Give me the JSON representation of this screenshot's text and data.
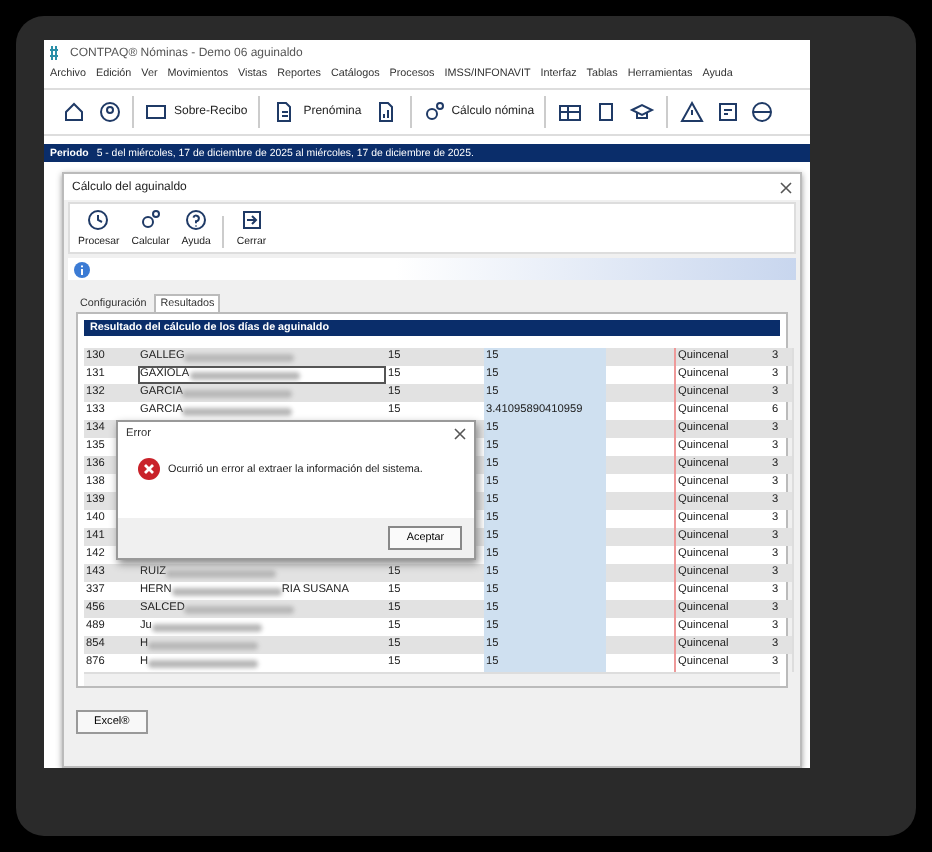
{
  "app_window": {
    "title": "CONTPAQ® Nóminas - Demo 06 aguinaldo"
  },
  "menu": [
    "Archivo",
    "Edición",
    "Ver",
    "Movimientos",
    "Vistas",
    "Reportes",
    "Catálogos",
    "Procesos",
    "IMSS/INFONAVIT",
    "Interfaz",
    "Tablas",
    "Herramientas",
    "Ayuda"
  ],
  "toolbar": [
    {
      "label": "Sobre-Recibo"
    },
    {
      "label": "Prenómina"
    },
    {
      "label": "Cálculo nómina"
    }
  ],
  "period": {
    "label": "Periodo",
    "text": "5 - del miércoles, 17 de diciembre de 2025 al miércoles, 17 de diciembre de 2025."
  },
  "dialog": {
    "title": "Cálculo del aguinaldo",
    "actions": [
      "Procesar",
      "Calcular",
      "Ayuda",
      "Cerrar"
    ],
    "tabs": [
      {
        "label": "Configuración",
        "selected": false
      },
      {
        "label": "Resultados",
        "selected": true
      }
    ],
    "grid_title": "Resultado del cálculo de los días de aguinaldo",
    "rows": [
      {
        "id": "130",
        "name": "GALLEG",
        "redacted": true,
        "col_3": "15",
        "col_4": "15",
        "col_6": "Quincenal",
        "col_7": "3",
        "selected": false
      },
      {
        "id": "131",
        "name": "GAXIOLA",
        "redacted": true,
        "col_3": "15",
        "col_4": "15",
        "col_6": "Quincenal",
        "col_7": "3",
        "selected": true
      },
      {
        "id": "132",
        "name": "GARCIA",
        "redacted": true,
        "col_3": "15",
        "col_4": "15",
        "col_6": "Quincenal",
        "col_7": "3",
        "selected": false
      },
      {
        "id": "133",
        "name": "GARCIA",
        "redacted": true,
        "col_3": "15",
        "col_4": "3.41095890410959",
        "col_6": "Quincenal",
        "col_7": "6",
        "selected": false
      },
      {
        "id": "134",
        "col_4": "15",
        "col_6": "Quincenal",
        "col_7": "3"
      },
      {
        "id": "135",
        "col_4": "15",
        "col_6": "Quincenal",
        "col_7": "3"
      },
      {
        "id": "136",
        "col_4": "15",
        "col_6": "Quincenal",
        "col_7": "3"
      },
      {
        "id": "138",
        "col_4": "15",
        "col_6": "Quincenal",
        "col_7": "3"
      },
      {
        "id": "139",
        "col_4": "15",
        "col_6": "Quincenal",
        "col_7": "3"
      },
      {
        "id": "140",
        "col_4": "15",
        "col_6": "Quincenal",
        "col_7": "3"
      },
      {
        "id": "141",
        "col_4": "15",
        "col_6": "Quincenal",
        "col_7": "3"
      },
      {
        "id": "142",
        "col_4": "15",
        "col_6": "Quincenal",
        "col_7": "3"
      },
      {
        "id": "143",
        "name": "RUIZ",
        "redacted": true,
        "col_3": "15",
        "col_4": "15",
        "col_6": "Quincenal",
        "col_7": "3",
        "selected": false
      },
      {
        "id": "337",
        "name": "HERN",
        "redacted": true,
        "name_end": "RIA SUSANA",
        "col_3": "15",
        "col_4": "15",
        "col_6": "Quincenal",
        "col_7": "3",
        "selected": false
      },
      {
        "id": "456",
        "name": "SALCED",
        "redacted": true,
        "col_3": "15",
        "col_4": "15",
        "col_6": "Quincenal",
        "col_7": "3",
        "selected": false
      },
      {
        "id": "489",
        "name": "Ju",
        "redacted": true,
        "col_3": "15",
        "col_4": "15",
        "col_6": "Quincenal",
        "col_7": "3",
        "selected": false
      },
      {
        "id": "854",
        "name": "H",
        "redacted": true,
        "col_3": "15",
        "col_4": "15",
        "col_6": "Quincenal",
        "col_7": "3",
        "selected": false
      },
      {
        "id": "876",
        "name": "H",
        "redacted": true,
        "col_3": "15",
        "col_4": "15",
        "col_6": "Quincenal",
        "col_7": "3",
        "selected": false
      }
    ],
    "export_button": "Excel®"
  },
  "error_dialog": {
    "title": "Error",
    "message": "Ocurrió un error al extraer la información del sistema.",
    "button": "Aceptar"
  }
}
